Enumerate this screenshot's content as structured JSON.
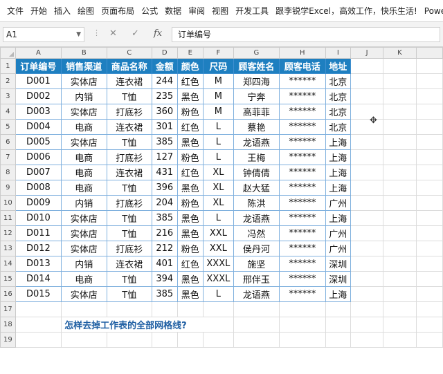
{
  "menu": [
    "文件",
    "开始",
    "插入",
    "绘图",
    "页面布局",
    "公式",
    "数据",
    "审阅",
    "视图",
    "开发工具",
    "跟李锐学Excel，高效工作，快乐生活!",
    "Power Pivot"
  ],
  "formula_bar": {
    "name_box": "A1",
    "cancel_glyph": "✕",
    "confirm_glyph": "✓",
    "fx_label": "fx",
    "formula": "订单编号"
  },
  "columns": [
    "A",
    "B",
    "C",
    "D",
    "E",
    "F",
    "G",
    "H",
    "I",
    "J",
    "K"
  ],
  "table": {
    "headers": [
      "订单编号",
      "销售渠道",
      "商品名称",
      "金额",
      "颜色",
      "尺码",
      "顾客姓名",
      "顾客电话",
      "地址"
    ],
    "rows": [
      [
        "D001",
        "实体店",
        "连衣裙",
        "244",
        "红色",
        "M",
        "郑四海",
        "******",
        "北京"
      ],
      [
        "D002",
        "内销",
        "T恤",
        "235",
        "黑色",
        "M",
        "宁奔",
        "******",
        "北京"
      ],
      [
        "D003",
        "实体店",
        "打底衫",
        "360",
        "粉色",
        "M",
        "高菲菲",
        "******",
        "北京"
      ],
      [
        "D004",
        "电商",
        "连衣裙",
        "301",
        "红色",
        "L",
        "蔡艳",
        "******",
        "北京"
      ],
      [
        "D005",
        "实体店",
        "T恤",
        "385",
        "黑色",
        "L",
        "龙语燕",
        "******",
        "上海"
      ],
      [
        "D006",
        "电商",
        "打底衫",
        "127",
        "粉色",
        "L",
        "王梅",
        "******",
        "上海"
      ],
      [
        "D007",
        "电商",
        "连衣裙",
        "431",
        "红色",
        "XL",
        "钟倩倩",
        "******",
        "上海"
      ],
      [
        "D008",
        "电商",
        "T恤",
        "396",
        "黑色",
        "XL",
        "赵大猛",
        "******",
        "上海"
      ],
      [
        "D009",
        "内销",
        "打底衫",
        "204",
        "粉色",
        "XL",
        "陈洪",
        "******",
        "广州"
      ],
      [
        "D010",
        "实体店",
        "T恤",
        "385",
        "黑色",
        "L",
        "龙语燕",
        "******",
        "上海"
      ],
      [
        "D011",
        "实体店",
        "T恤",
        "216",
        "黑色",
        "XXL",
        "冯然",
        "******",
        "广州"
      ],
      [
        "D012",
        "实体店",
        "打底衫",
        "212",
        "粉色",
        "XXL",
        "侯丹河",
        "******",
        "广州"
      ],
      [
        "D013",
        "内销",
        "连衣裙",
        "401",
        "红色",
        "XXXL",
        "施坚",
        "******",
        "深圳"
      ],
      [
        "D014",
        "电商",
        "T恤",
        "394",
        "黑色",
        "XXXL",
        "邢伴玉",
        "******",
        "深圳"
      ],
      [
        "D015",
        "实体店",
        "T恤",
        "385",
        "黑色",
        "L",
        "龙语燕",
        "******",
        "上海"
      ]
    ]
  },
  "question": "怎样去掉工作表的全部网格线?",
  "total_rows": 19,
  "question_row": 18,
  "cursor_glyph": "✥",
  "colors": {
    "header_fill": "#1e7fc0",
    "header_text": "#ffffff",
    "question_text": "#1f5fa3"
  }
}
